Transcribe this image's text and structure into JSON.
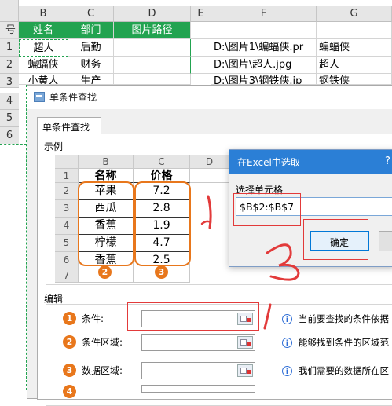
{
  "sheet": {
    "col_headers": [
      "B",
      "C",
      "D",
      "E",
      "F",
      "G"
    ],
    "row_numbers": [
      "1",
      "2",
      "3",
      "4",
      "5",
      "6"
    ],
    "first_col_partial": "号",
    "header_row": [
      "姓名",
      "部门",
      "图片路径"
    ],
    "rows": [
      [
        "超人",
        "后勤",
        "",
        "D:\\图片1\\蝙蝠侠.pr",
        "蝙蝠侠"
      ],
      [
        "蝙蝠侠",
        "财务",
        "",
        "D:\\图片\\超人.jpg",
        "超人"
      ],
      [
        "小黄人",
        "生产",
        "",
        "D:\\图片3\\钢铁侠.jp",
        "钢铁侠"
      ]
    ]
  },
  "main_dialog": {
    "title": "单条件查找",
    "tab": "单条件查找",
    "example_group": "示例",
    "edit_group": "编辑",
    "mini": {
      "col_headers": [
        "B",
        "C",
        "D"
      ],
      "row_numbers": [
        "1",
        "2",
        "3",
        "4",
        "5",
        "6",
        "7"
      ],
      "header": [
        "名称",
        "价格"
      ],
      "names": [
        "苹果",
        "西瓜",
        "香蕉",
        "柠檬",
        "香蕉"
      ],
      "prices": [
        "7.2",
        "2.8",
        "1.9",
        "4.7",
        "2.5"
      ],
      "marker_b": "2",
      "marker_c": "3"
    },
    "fields": [
      {
        "num": "1",
        "label": "条件:",
        "hint": "当前要查找的条件依据"
      },
      {
        "num": "2",
        "label": "条件区域:",
        "hint": "能够找到条件的区域范"
      },
      {
        "num": "3",
        "label": "数据区域:",
        "hint": "我们需要的数据所在区"
      },
      {
        "num": "4",
        "label": "",
        "hint": ""
      }
    ]
  },
  "select_dialog": {
    "title": "在Excel中选取",
    "help": "?",
    "prompt": "选择单元格",
    "value": "$B$2:$B$7",
    "ok": "确定"
  },
  "annotations": {
    "numbers": [
      "1",
      "2",
      "3",
      "1"
    ],
    "accent_color": "#e23a3a",
    "ring_color": "#e8771c",
    "header_green": "#22a350"
  }
}
